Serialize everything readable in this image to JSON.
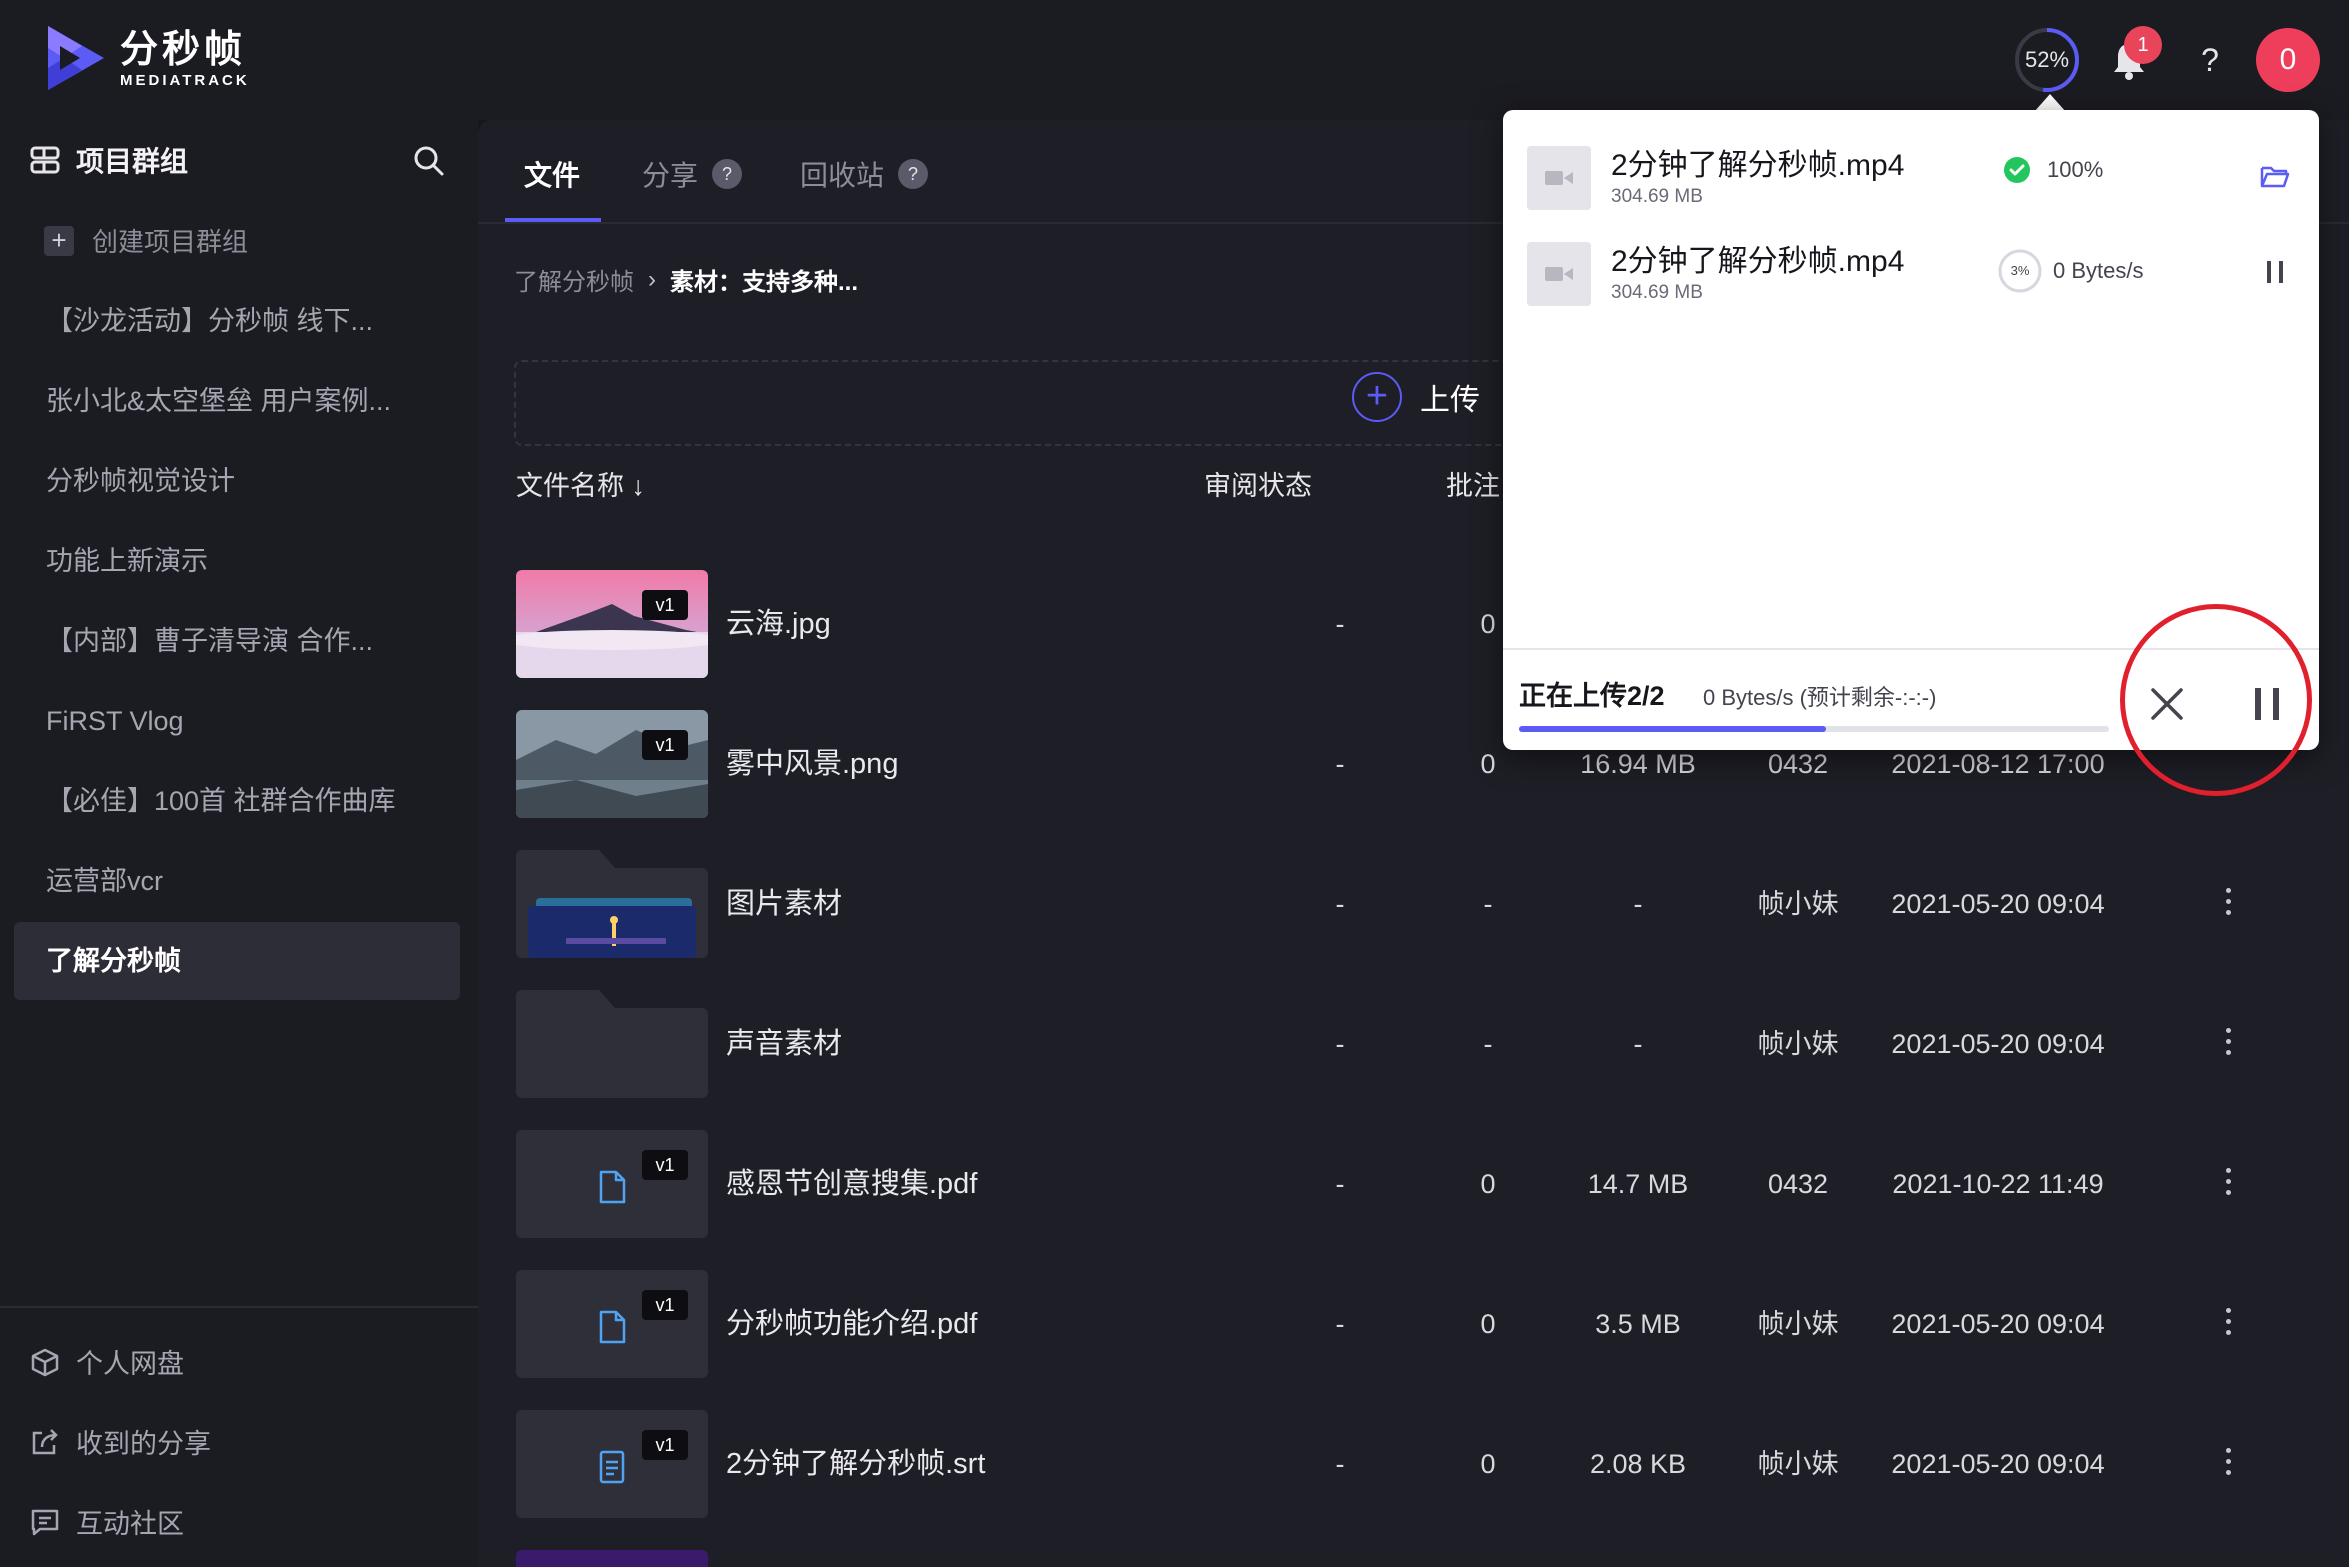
{
  "brand": {
    "name_cn": "分秒帧",
    "name_en": "MEDIATRACK",
    "accent": "#5b5bf5"
  },
  "topbar": {
    "upload_progress": "52%",
    "upload_progress_fraction": 0.52,
    "notification_count": "1",
    "help_label": "?",
    "avatar_initial": "0"
  },
  "sidebar": {
    "header": "项目群组",
    "create_label": "创建项目群组",
    "items": [
      {
        "label": "【沙龙活动】分秒帧 线下..."
      },
      {
        "label": "张小北&太空堡垒 用户案例..."
      },
      {
        "label": "分秒帧视觉设计"
      },
      {
        "label": "功能上新演示"
      },
      {
        "label": "【内部】曹子清导演 合作..."
      },
      {
        "label": "FiRST Vlog"
      },
      {
        "label": "【必佳】100首 社群合作曲库"
      },
      {
        "label": "运营部vcr"
      },
      {
        "label": "了解分秒帧"
      }
    ],
    "bottom": [
      {
        "label": "个人网盘",
        "icon": "box-icon"
      },
      {
        "label": "收到的分享",
        "icon": "share-in-icon"
      },
      {
        "label": "互动社区",
        "icon": "community-icon"
      }
    ]
  },
  "main": {
    "tabs": [
      {
        "label": "文件"
      },
      {
        "label": "分享",
        "help": "?"
      },
      {
        "label": "回收站",
        "help": "?"
      }
    ],
    "breadcrumb": {
      "parent": "了解分秒帧",
      "current": "素材：支持多种..."
    },
    "upload_label": "上传",
    "columns": {
      "name": "文件名称",
      "review": "审阅状态",
      "comments": "批注"
    },
    "files": [
      {
        "name": "云海.jpg",
        "version": "v1",
        "review": "-",
        "comments": "0",
        "size": "",
        "uploader": "",
        "date": ""
      },
      {
        "name": "雾中风景.png",
        "version": "v1",
        "review": "-",
        "comments": "0",
        "size": "16.94 MB",
        "uploader": "0432",
        "date": "2021-08-12 17:00"
      },
      {
        "name": "图片素材",
        "version": "",
        "review": "-",
        "comments": "-",
        "size": "-",
        "uploader": "帧小妹",
        "date": "2021-05-20 09:04"
      },
      {
        "name": "声音素材",
        "version": "",
        "review": "-",
        "comments": "-",
        "size": "-",
        "uploader": "帧小妹",
        "date": "2021-05-20 09:04"
      },
      {
        "name": "感恩节创意搜集.pdf",
        "version": "v1",
        "review": "-",
        "comments": "0",
        "size": "14.7 MB",
        "uploader": "0432",
        "date": "2021-10-22 11:49"
      },
      {
        "name": "分秒帧功能介绍.pdf",
        "version": "v1",
        "review": "-",
        "comments": "0",
        "size": "3.5 MB",
        "uploader": "帧小妹",
        "date": "2021-05-20 09:04"
      },
      {
        "name": "2分钟了解分秒帧.srt",
        "version": "v1",
        "review": "-",
        "comments": "0",
        "size": "2.08 KB",
        "uploader": "帧小妹",
        "date": "2021-05-20 09:04"
      }
    ]
  },
  "upload_panel": {
    "items": [
      {
        "name": "2分钟了解分秒帧.mp4",
        "size": "304.69 MB",
        "status": "100%",
        "status_icon": "check-circle-icon",
        "action_icon": "folder-open-icon"
      },
      {
        "name": "2分钟了解分秒帧.mp4",
        "size": "304.69 MB",
        "progress": "3%",
        "status": "0 Bytes/s",
        "action_icon": "pause-icon"
      }
    ],
    "footer": {
      "title": "正在上传2/2",
      "speed": "0 Bytes/s (预计剩余-:-:-)",
      "progress_fraction": 0.52
    }
  }
}
